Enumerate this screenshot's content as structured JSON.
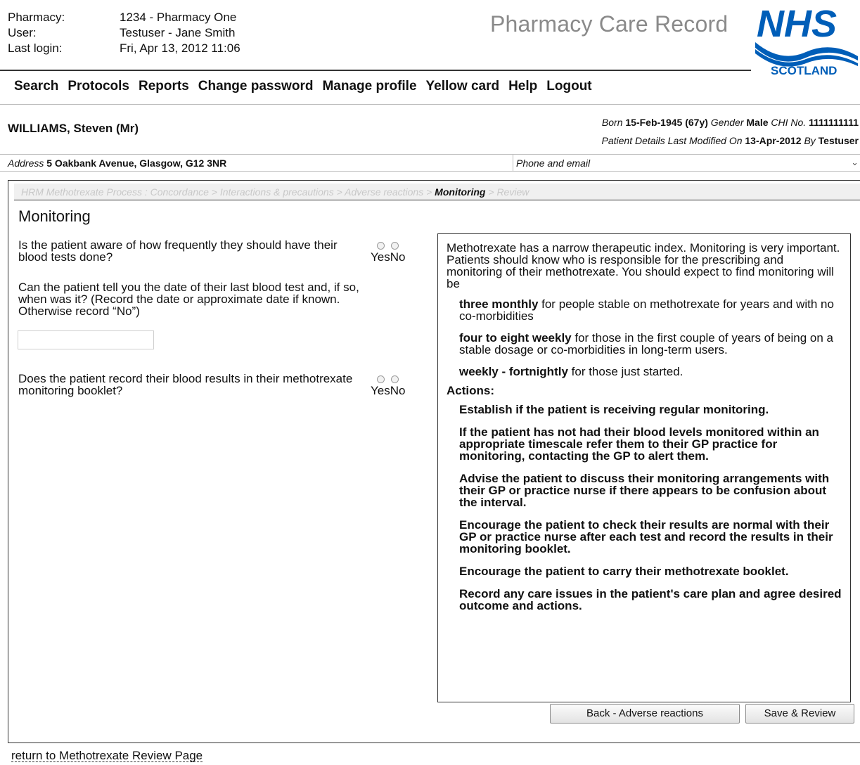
{
  "header": {
    "pharmacy_label": "Pharmacy:",
    "pharmacy_value": "1234 - Pharmacy One",
    "user_label": "User:",
    "user_value": "Testuser - Jane Smith",
    "login_label": "Last login:",
    "login_value": "Fri, Apr 13, 2012 11:06",
    "app_title": "Pharmacy Care Record",
    "logo_nhs": "NHS",
    "logo_scotland": "SCOTLAND",
    "logo_color": "#005eb8"
  },
  "nav": [
    "Search",
    "Protocols",
    "Reports",
    "Change password",
    "Manage profile",
    "Yellow card",
    "Help",
    "Logout"
  ],
  "patient": {
    "name": "WILLIAMS, Steven (Mr)",
    "born_label": "Born",
    "born_value": "15-Feb-1945",
    "age": "(67y)",
    "gender_label": "Gender",
    "gender_value": "Male",
    "chi_label": "CHI No.",
    "chi_value": "1111111111",
    "modified_label": "Patient Details Last Modified On",
    "modified_value": "13-Apr-2012",
    "by_label": "By",
    "by_value": "Testuser",
    "address_label": "Address",
    "address_value": "5 Oakbank Avenue, Glasgow, G12 3NR",
    "phone_label": "Phone and email",
    "phone_icon": "chevron-down-icon"
  },
  "breadcrumb": {
    "before": "HRM Methotrexate Process : Concordance > Interactions & precautions > Adverse reactions >",
    "current": "Monitoring",
    "after": "> Review"
  },
  "page_title": "Monitoring",
  "questions": [
    {
      "text": "Is the patient aware of how frequently they should have their blood tests done?",
      "yes": "Yes",
      "no": "No"
    },
    {
      "text": "Can the patient tell you the date of their last blood test and, if so, when was it? (Record the date or approximate date if known. Otherwise record “No”)",
      "value": ""
    },
    {
      "text": "Does the patient record their blood results in their methotrexate monitoring booklet?",
      "yes": "Yes",
      "no": "No"
    }
  ],
  "info": {
    "intro": "Methotrexate has a narrow therapeutic index. Monitoring is very important. Patients should know who is responsible for the prescribing and monitoring of their methotrexate. You should expect to find monitoring will be",
    "items": [
      {
        "bold": "three monthly",
        "text": " for people stable on methotrexate for years and with no co-morbidities"
      },
      {
        "bold": "four to eight weekly",
        "text": " for those in the first couple of years of being on a stable dosage or co-morbidities in long-term users."
      },
      {
        "bold": "weekly - fortnightly",
        "text": " for those just started."
      }
    ],
    "actions_heading": "Actions:",
    "actions": [
      "Establish if the patient is receiving regular monitoring.",
      "If the patient has not had their blood levels monitored within an appropriate timescale refer them to their GP practice for monitoring, contacting the GP to alert them.",
      "Advise the patient to discuss their monitoring arrangements with their GP or practice nurse if there appears to be confusion about the interval.",
      "Encourage the patient to check their results are normal with their GP or practice nurse after each test and record the results in their monitoring booklet.",
      "Encourage the patient to carry their methotrexate booklet.",
      "Record any care issues in the patient's care plan and agree desired outcome and actions."
    ]
  },
  "buttons": {
    "back": "Back - Adverse reactions",
    "save": "Save & Review"
  },
  "return_link": "return to Methotrexate Review Page"
}
